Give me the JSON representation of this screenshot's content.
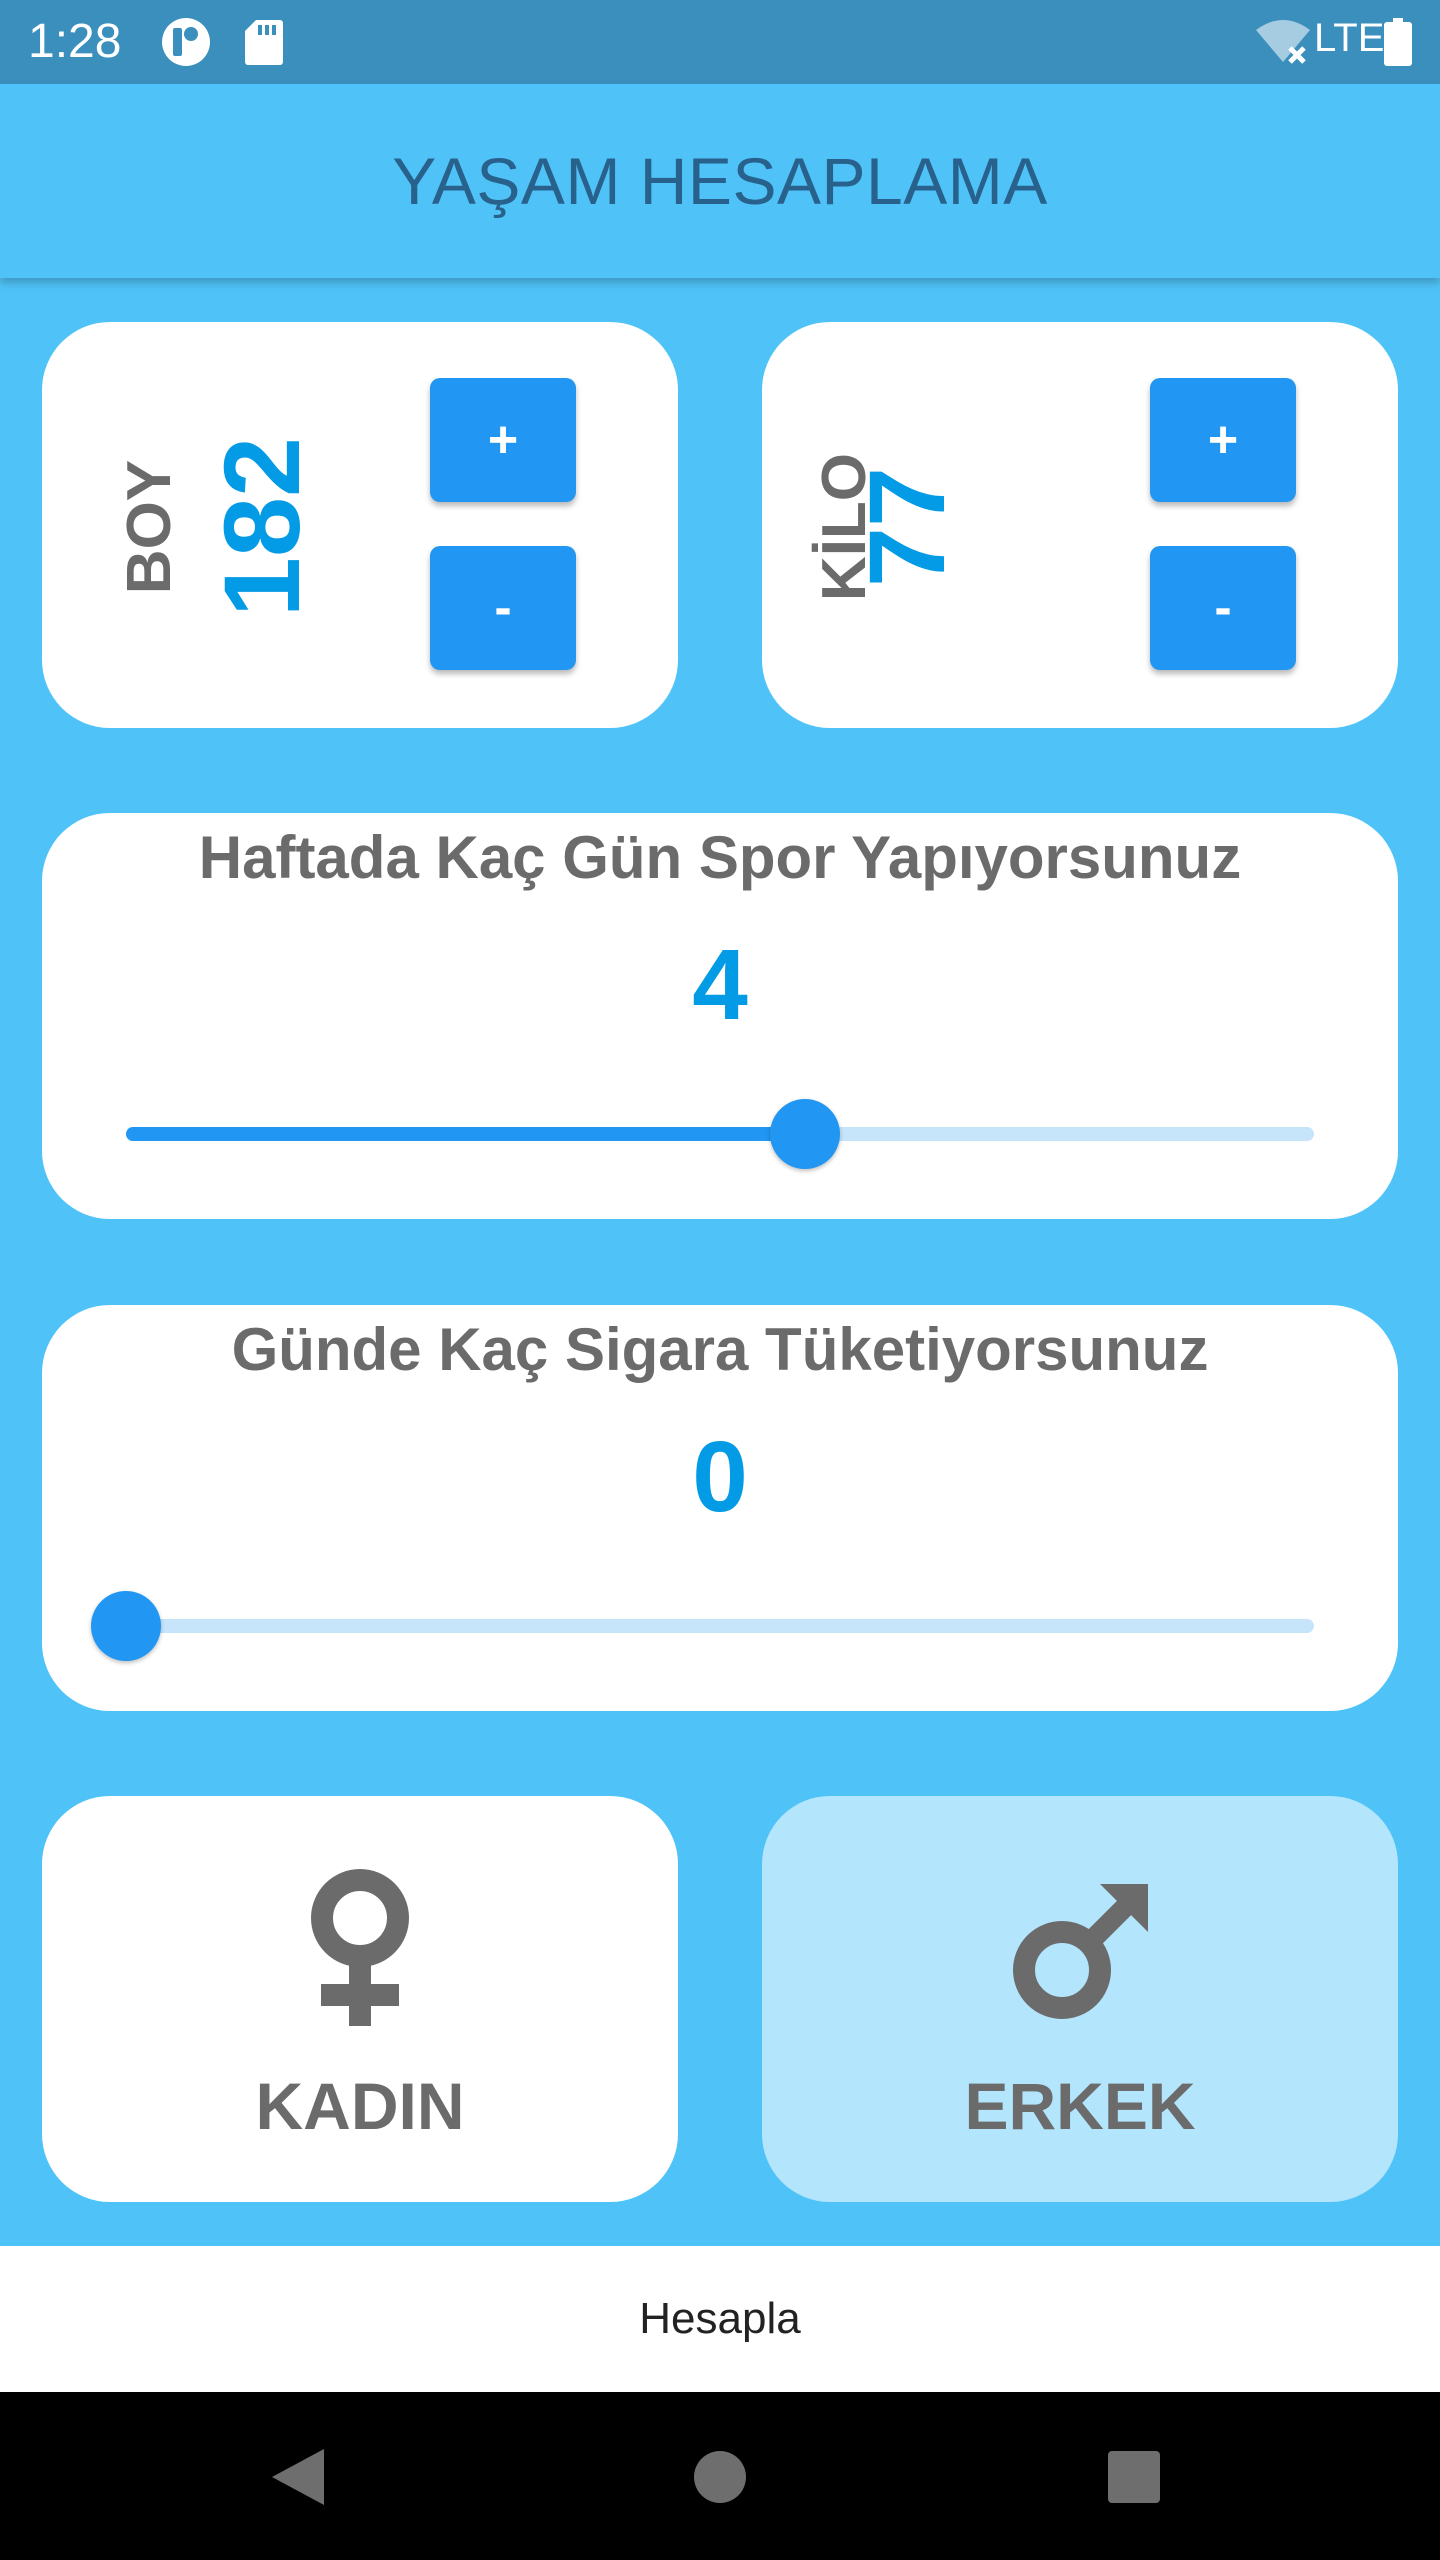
{
  "status_bar": {
    "time": "1:28",
    "network": "LTE",
    "icons": [
      "notification-icon",
      "sd-card-icon",
      "wifi-off-icon",
      "battery-icon"
    ]
  },
  "app_bar": {
    "title": "YAŞAM HESAPLAMA"
  },
  "height_card": {
    "label": "BOY",
    "value": "182",
    "plus_label": "+",
    "minus_label": "-"
  },
  "weight_card": {
    "label": "KİLO",
    "value": "77",
    "plus_label": "+",
    "minus_label": "-"
  },
  "sport_card": {
    "title": "Haftada Kaç Gün Spor Yapıyorsunuz",
    "value": "4",
    "slider": {
      "min": 0,
      "max": 7,
      "value": 4
    }
  },
  "cigarette_card": {
    "title": "Günde Kaç Sigara Tüketiyorsunuz",
    "value": "0",
    "slider": {
      "min": 0,
      "max": 30,
      "value": 0
    }
  },
  "gender": {
    "female_label": "KADIN",
    "male_label": "ERKEK",
    "selected": "male",
    "female_icon": "female-symbol-icon",
    "male_icon": "male-symbol-icon"
  },
  "calculate_button": {
    "label": "Hesapla"
  },
  "nav_bar": {
    "icons": [
      "back-icon",
      "home-icon",
      "recents-icon"
    ]
  },
  "colors": {
    "background": "#4fc3f7",
    "primary": "#2196f3",
    "value_text": "#039be5",
    "selected_card": "#b3e5fc",
    "title_text": "#27618c"
  }
}
